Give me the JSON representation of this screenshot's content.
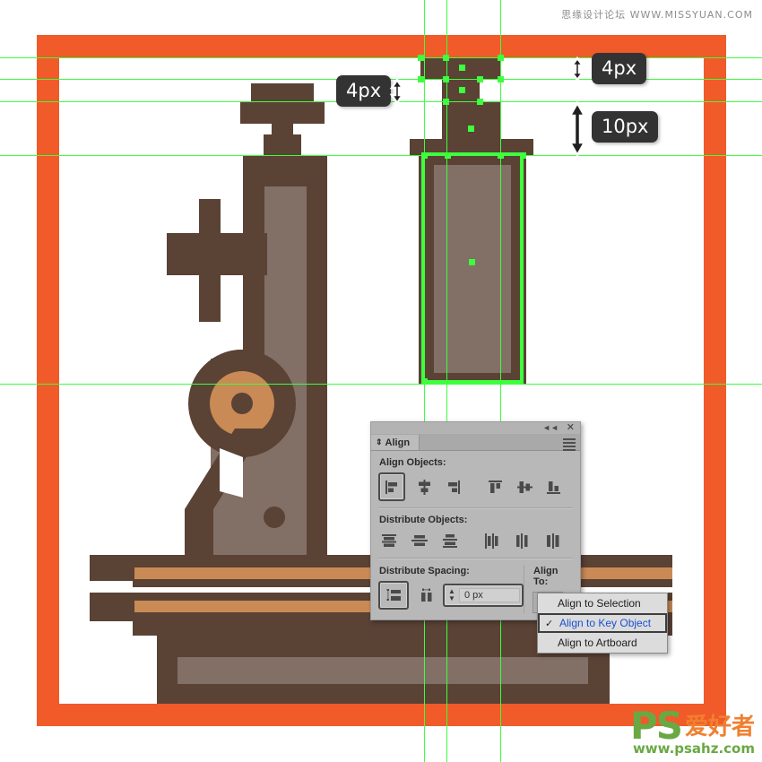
{
  "watermarks": {
    "top": "思缘设计论坛  WWW.MISSYUAN.COM",
    "brand_ps": "PS",
    "brand_cn": "爱好者",
    "brand_url": "www.psahz.com"
  },
  "measurements": [
    {
      "id": "left-4px",
      "value": "4px"
    },
    {
      "id": "top-right-4px",
      "value": "4px"
    },
    {
      "id": "right-10px",
      "value": "10px"
    }
  ],
  "panel": {
    "title": "Align",
    "collapse_icon": "collapse-icon",
    "close_icon": "close-icon",
    "menu_icon": "panel-menu-icon",
    "sections": {
      "align_objects_label": "Align Objects:",
      "distribute_objects_label": "Distribute Objects:",
      "distribute_spacing_label": "Distribute Spacing:",
      "align_to_label": "Align To:"
    },
    "align_objects_buttons": [
      "horizontal-align-left",
      "horizontal-align-center",
      "horizontal-align-right",
      "vertical-align-top",
      "vertical-align-center",
      "vertical-align-bottom"
    ],
    "distribute_objects_buttons": [
      "vertical-distribute-top",
      "vertical-distribute-center",
      "vertical-distribute-bottom",
      "horizontal-distribute-left",
      "horizontal-distribute-center",
      "horizontal-distribute-right"
    ],
    "distribute_spacing_buttons": [
      "vertical-distribute-space",
      "horizontal-distribute-space"
    ],
    "spacing_value": "0 px",
    "align_to_value": "align-to-key-object-icon"
  },
  "dropdown": {
    "items": [
      {
        "label": "Align to Selection",
        "checked": false
      },
      {
        "label": "Align to Key Object",
        "checked": true
      },
      {
        "label": "Align to Artboard",
        "checked": false
      }
    ],
    "check_glyph": "✓"
  },
  "colors": {
    "artboard_border": "#f15a29",
    "guide_green": "#3dff3d",
    "shape_dark": "#5a4235",
    "shape_mid": "#827067",
    "shape_tan": "#ca8a55",
    "label_bg": "#333333"
  },
  "guides": {
    "horizontal": [
      64,
      88,
      113,
      173,
      428
    ],
    "vertical": [
      473,
      498,
      558
    ]
  }
}
